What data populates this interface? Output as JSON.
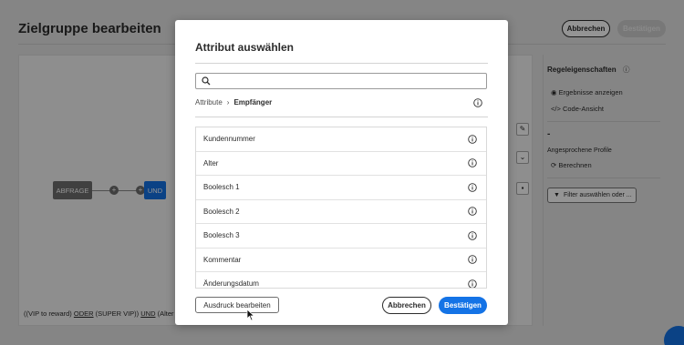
{
  "page": {
    "title": "Zielgruppe bearbeiten",
    "cancel_label": "Abbrechen",
    "confirm_label": "Bestätigen"
  },
  "canvas": {
    "node_query": "ABFRAGE",
    "node_and": "UND",
    "plus_symbol": "+",
    "expression": {
      "p1": "((VIP to reward) ",
      "op1": "ODER",
      "p2": " (SUPER VIP)) ",
      "op2": "UND",
      "p3": " (Alter gr"
    }
  },
  "right_panel": {
    "title": "Regeleigenschaften",
    "show_results": "Ergebnisse anzeigen",
    "code_view": "Code-Ansicht",
    "count_value": "-",
    "profiles_label": "Angesprochene Profile",
    "calculate": "Berechnen",
    "filter_button": "Filter auswählen oder ..."
  },
  "modal": {
    "title": "Attribut auswählen",
    "search_placeholder": "",
    "breadcrumb_root": "Attribute",
    "breadcrumb_separator": "›",
    "breadcrumb_current": "Empfänger",
    "items": [
      "Kundennummer",
      "Alter",
      "Boolesch 1",
      "Boolesch 2",
      "Boolesch 3",
      "Kommentar",
      "Änderungsdatum"
    ],
    "edit_expression_label": "Ausdruck bearbeiten",
    "cancel_label": "Abbrechen",
    "confirm_label": "Bestätigen"
  },
  "colors": {
    "accent": "#1473e6",
    "overlay": "#000000",
    "node_gray": "#6e6e6e"
  }
}
